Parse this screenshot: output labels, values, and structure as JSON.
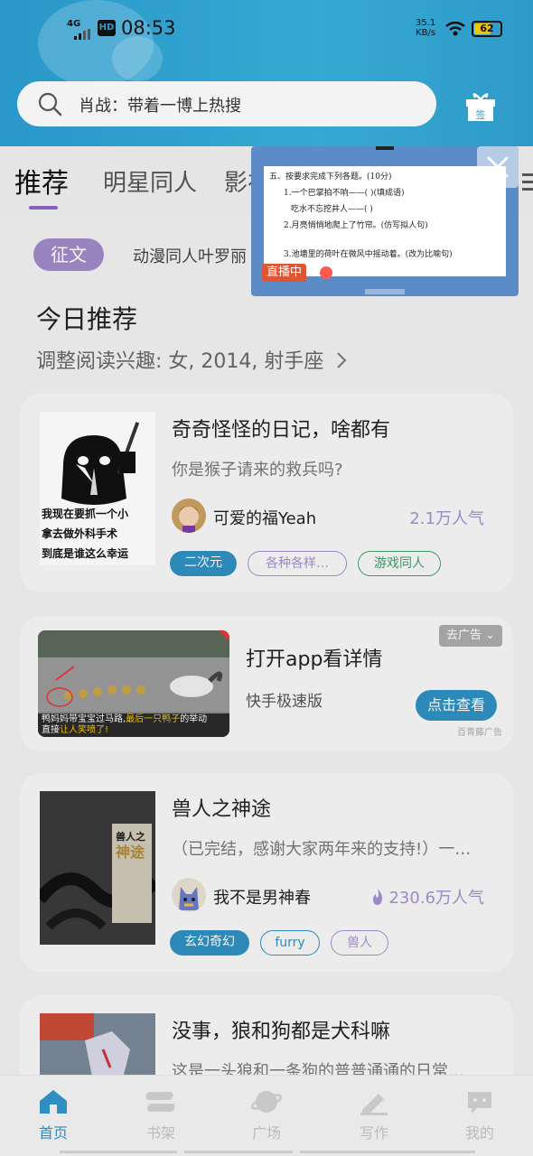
{
  "status_bar": {
    "network": "4G",
    "hd": "HD",
    "time": "08:53",
    "speed_value": "35.1",
    "speed_unit": "KB/s",
    "battery": "62"
  },
  "search": {
    "placeholder": "肖战：带着一博上热搜"
  },
  "gift_label": "签",
  "tabs": [
    {
      "label": "推荐",
      "active": true
    },
    {
      "label": "明星同人",
      "active": false
    },
    {
      "label": "影视",
      "active": false
    }
  ],
  "notice": {
    "badge": "征文",
    "text": "动漫同人叶罗丽"
  },
  "section": {
    "title": "今日推荐",
    "subtitle": "调整阅读兴趣: 女, 2014, 射手座"
  },
  "cards": [
    {
      "title": "奇奇怪怪的日记，啥都有",
      "desc": "你是猴子请来的救兵吗?",
      "author": "可爱的福Yeah",
      "popularity": "2.1万人气",
      "cover_text": [
        "我现在要抓一个小",
        "拿去做外科手术",
        "到底是谁这么幸运"
      ],
      "tags": [
        "二次元",
        "各种各样…",
        "游戏同人"
      ]
    },
    {
      "title": "兽人之神途",
      "desc": "（已完结，感谢大家两年来的支持!）一…",
      "author": "我不是男神春",
      "popularity": "230.6万人气",
      "cover_text": [
        "兽人之",
        "神途"
      ],
      "tags": [
        "玄幻奇幻",
        "furry",
        "兽人"
      ]
    },
    {
      "title": "没事，狼和狗都是犬科嘛",
      "desc": "这是一头狼和一条狗的普普通通的日常…"
    }
  ],
  "ad": {
    "title": "打开app看详情",
    "subtitle": "快手极速版",
    "remove": "去广告",
    "button": "点击查看",
    "source": "百青藤广告",
    "caption_1": "鸭妈妈带宝宝过马路,",
    "caption_highlight": "最后一只鸭子",
    "caption_2": "的举动",
    "caption_3": "直接",
    "caption_4": "让人笑喷了!"
  },
  "live_window": {
    "badge": "直播中",
    "lines": [
      "五、按要求完成下列各题。(10分)",
      "1.一个巴掌拍不响——(          )(填成语)",
      "吃水不忘挖井人——(          )",
      "2.月亮悄悄地爬上了竹帘。(仿写拟人句)",
      "3.池塘里的荷叶在微风中摇动着。(改为比喻句)"
    ]
  },
  "bottom_nav": [
    {
      "label": "首页",
      "icon": "home-icon",
      "active": true
    },
    {
      "label": "书架",
      "icon": "bookshelf-icon",
      "active": false
    },
    {
      "label": "广场",
      "icon": "planet-icon",
      "active": false
    },
    {
      "label": "写作",
      "icon": "pen-icon",
      "active": false
    },
    {
      "label": "我的",
      "icon": "chat-bubble-icon",
      "active": false
    }
  ],
  "colors": {
    "header": "#35a9d3",
    "accent_purple": "#a08ac7",
    "accent_blue": "#2f8fc0"
  }
}
